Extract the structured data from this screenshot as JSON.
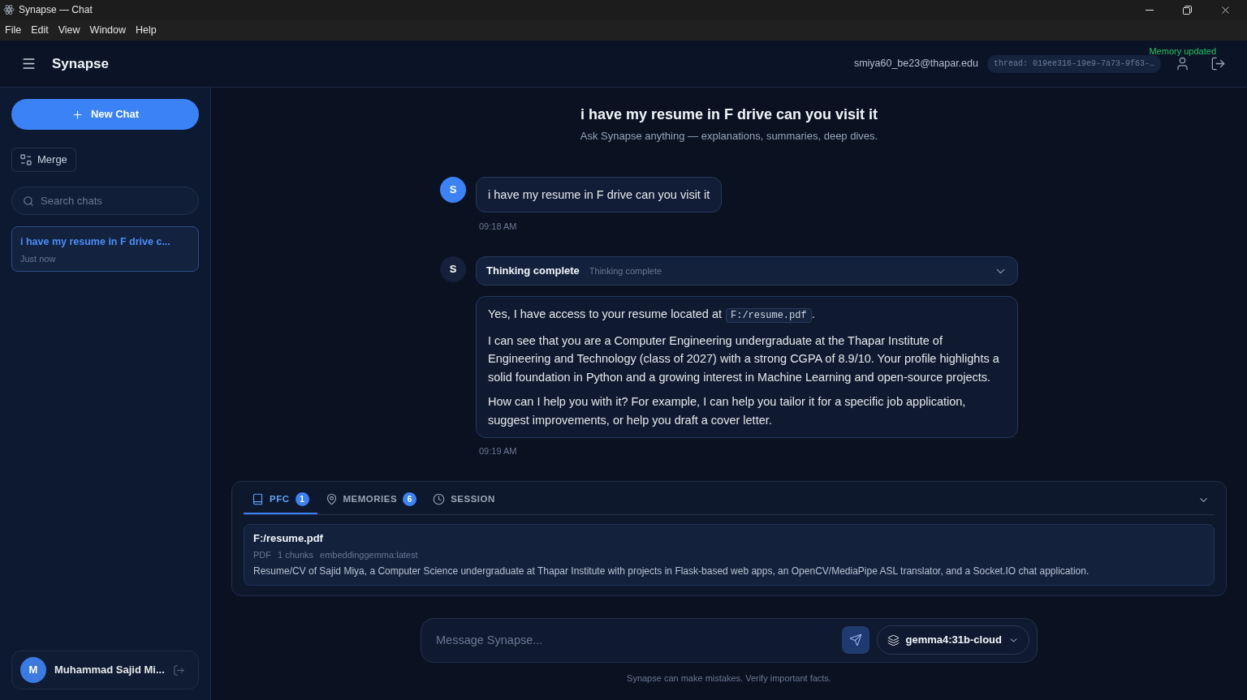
{
  "window": {
    "title": "Synapse — Chat",
    "menu": [
      "File",
      "Edit",
      "View",
      "Window",
      "Help"
    ]
  },
  "header": {
    "app_name": "Synapse",
    "email": "smiya60_be23@thapar.edu",
    "thread": "thread: 019ee316-19e9-7a73-9f63-…",
    "toast": "Memory updated"
  },
  "sidebar": {
    "new_chat": "New Chat",
    "merge": "Merge",
    "search": {
      "placeholder": "Search chats"
    },
    "chats": [
      {
        "title": "i have my resume in F drive c...",
        "time": "Just now",
        "selected": true
      }
    ],
    "user": {
      "initial": "M",
      "name": "Muhammad Sajid Mi..."
    }
  },
  "conversation": {
    "title": "i have my resume in F drive can you visit it",
    "subtitle": "Ask Synapse anything — explanations, summaries, deep dives.",
    "messages": [
      {
        "kind": "user",
        "avatar": "S",
        "text": "i have my resume in F drive can you visit it",
        "time": "09:18 AM"
      },
      {
        "kind": "assistant",
        "avatar": "S",
        "thinking": {
          "label": "Thinking complete",
          "status": "Thinking complete",
          "expanded": false
        },
        "paragraphs": [
          {
            "segments": [
              {
                "kind": "text",
                "text": "Yes, I have access to your resume located at"
              },
              {
                "kind": "code",
                "text": "F:/resume.pdf"
              },
              {
                "kind": "text",
                "text": "."
              }
            ]
          },
          {
            "segments": [
              {
                "kind": "text",
                "text": "I can see that you are a Computer Engineering undergraduate at the Thapar Institute of Engineering and Technology (class of 2027) with a strong CGPA of 8.9/10. Your profile highlights a solid foundation in Python and a growing interest in Machine Learning and open-source projects."
              }
            ]
          },
          {
            "segments": [
              {
                "kind": "text",
                "text": "How can I help you with it? For example, I can help you tailor it for a specific job application, suggest improvements, or help you draft a cover letter."
              }
            ]
          }
        ],
        "time": "09:19 AM"
      }
    ]
  },
  "context_panel": {
    "tabs": [
      {
        "kind": "document",
        "label": "PFC",
        "count": "1",
        "selected": true
      },
      {
        "kind": "memory",
        "label": "MEMORIES",
        "count": "6",
        "selected": false
      },
      {
        "kind": "session",
        "label": "SESSION",
        "selected": false
      }
    ],
    "documents": [
      {
        "name": "F:/resume.pdf",
        "type": "PDF",
        "chunks": "1 chunks",
        "model": "embeddinggemma:latest",
        "summary": "Resume/CV of Sajid Miya, a Computer Science undergraduate at Thapar Institute with projects in Flask-based web apps, an OpenCV/MediaPipe ASL translator, and a Socket.IO chat application."
      }
    ]
  },
  "composer": {
    "placeholder": "Message Synapse...",
    "model": "gemma4:31b-cloud"
  },
  "disclaimer": "Synapse can make mistakes. Verify important facts."
}
